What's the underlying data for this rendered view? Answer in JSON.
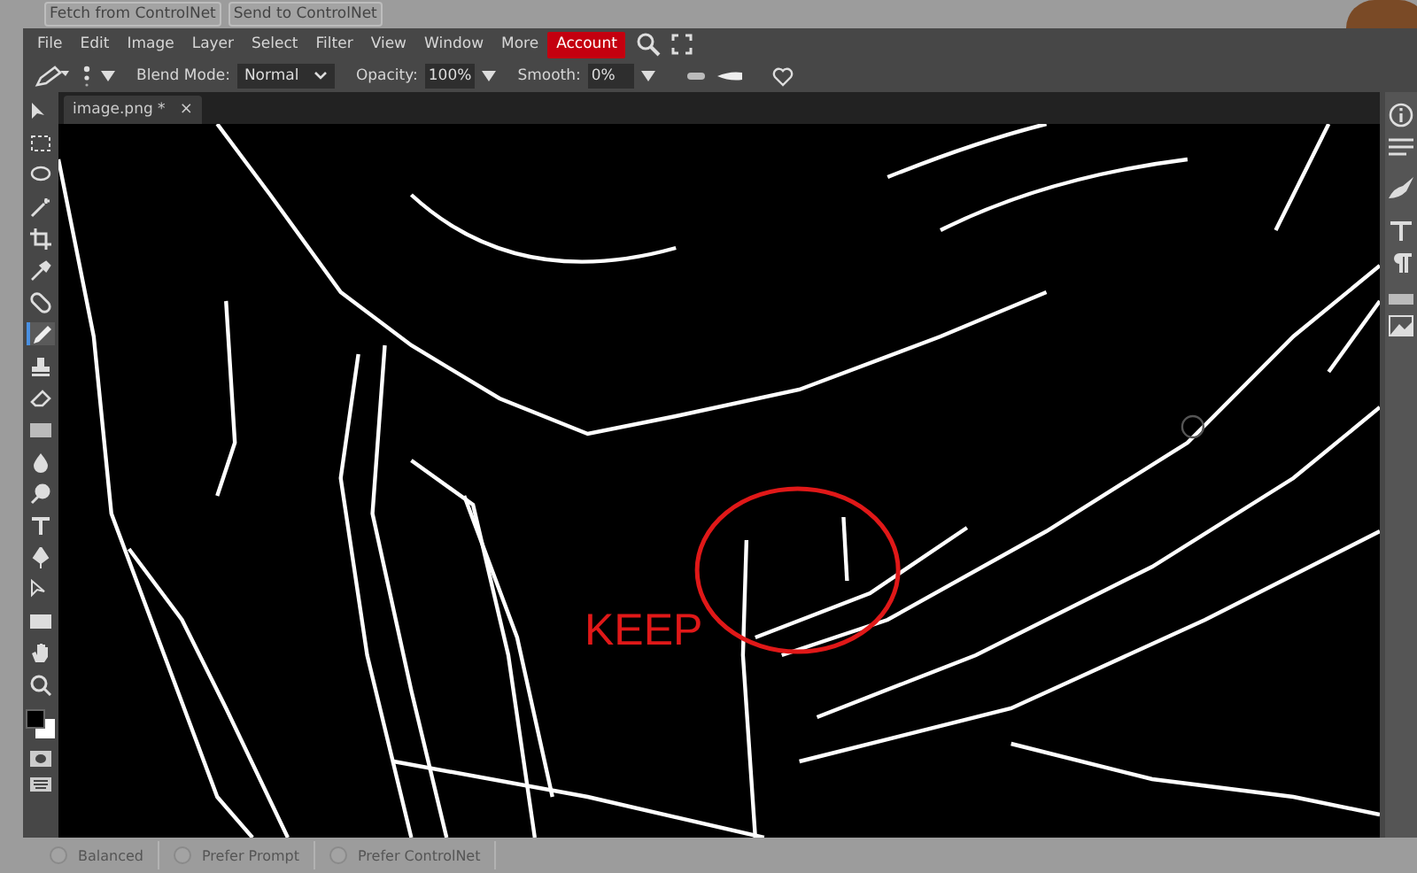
{
  "top_buttons": [
    "Fetch from ControlNet",
    "Send to ControlNet"
  ],
  "menu": [
    {
      "label": "File",
      "selected": false
    },
    {
      "label": "Edit",
      "selected": false
    },
    {
      "label": "Image",
      "selected": false
    },
    {
      "label": "Layer",
      "selected": false
    },
    {
      "label": "Select",
      "selected": false
    },
    {
      "label": "Filter",
      "selected": false
    },
    {
      "label": "View",
      "selected": false
    },
    {
      "label": "Window",
      "selected": false
    },
    {
      "label": "More",
      "selected": false
    },
    {
      "label": "Account",
      "selected": true
    }
  ],
  "options": {
    "blend_label": "Blend Mode:",
    "blend_value": "Normal",
    "opacity_label": "Opacity:",
    "opacity_value": "100%",
    "smooth_label": "Smooth:",
    "smooth_value": "0%"
  },
  "document_tab": {
    "title": "image.png *",
    "close": "×"
  },
  "tools": [
    {
      "kind": "move",
      "selected": false
    },
    {
      "kind": "marquee",
      "selected": false
    },
    {
      "kind": "lasso",
      "selected": false
    },
    {
      "kind": "wand",
      "selected": false
    },
    {
      "kind": "crop",
      "selected": false
    },
    {
      "kind": "eyedropper",
      "selected": false
    },
    {
      "kind": "bandage",
      "selected": false
    },
    {
      "kind": "pencil",
      "selected": true
    },
    {
      "kind": "stamp",
      "selected": false
    },
    {
      "kind": "eraser",
      "selected": false
    },
    {
      "kind": "gradient",
      "selected": false
    },
    {
      "kind": "drop",
      "selected": false
    },
    {
      "kind": "dodge",
      "selected": false
    },
    {
      "kind": "text",
      "selected": false
    },
    {
      "kind": "pen",
      "selected": false
    },
    {
      "kind": "path-select",
      "selected": false
    },
    {
      "kind": "rectangle",
      "selected": false
    },
    {
      "kind": "hand",
      "selected": false
    },
    {
      "kind": "zoom",
      "selected": false
    }
  ],
  "canvas": {
    "annotation": "KEEP"
  },
  "control_modes": [
    {
      "label": "Balanced",
      "selected": false
    },
    {
      "label": "Prefer Prompt",
      "selected": false
    },
    {
      "label": "Prefer ControlNet",
      "selected": false
    }
  ]
}
